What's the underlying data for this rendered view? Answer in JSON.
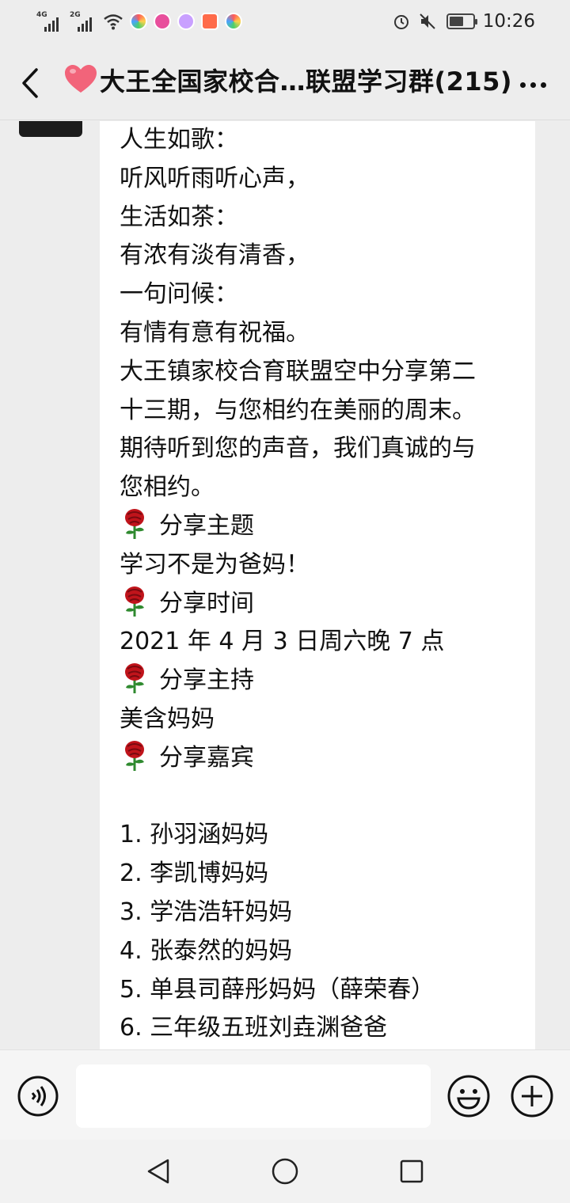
{
  "status_bar": {
    "signal_1_label": "4G",
    "signal_2_label": "2G",
    "time": "10:26",
    "battery_level_percent": 60,
    "app_icon_colors": [
      "#e84f9c",
      "#e84f9c",
      "#c9a0ff",
      "#ff6b4a",
      "#4aa3ff"
    ]
  },
  "header": {
    "title": "大王全国家校合…联盟学习群(215)",
    "title_icon": "heart-icon",
    "accent_color": "#f2647a"
  },
  "message": {
    "lines": [
      {
        "text": "人生如歌：",
        "rose": false
      },
      {
        "text": "听风听雨听心声，",
        "rose": false
      },
      {
        "text": "生活如茶：",
        "rose": false
      },
      {
        "text": "有浓有淡有清香，",
        "rose": false
      },
      {
        "text": "一句问候：",
        "rose": false
      },
      {
        "text": "有情有意有祝福。",
        "rose": false
      },
      {
        "text": "大王镇家校合育联盟空中分享第二",
        "rose": false
      },
      {
        "text": "十三期，与您相约在美丽的周末。",
        "rose": false
      },
      {
        "text": "期待听到您的声音，我们真诚的与",
        "rose": false
      },
      {
        "text": "您相约。",
        "rose": false
      },
      {
        "text": "分享主题",
        "rose": true
      },
      {
        "text": "学习不是为爸妈！",
        "rose": false
      },
      {
        "text": "分享时间",
        "rose": true
      },
      {
        "text": "2021 年 4 月 3 日周六晚 7 点",
        "rose": false
      },
      {
        "text": "分享主持",
        "rose": true
      },
      {
        "text": "美含妈妈",
        "rose": false
      },
      {
        "text": "分享嘉宾",
        "rose": true
      },
      {
        "text": "",
        "rose": false
      },
      {
        "text": "1. 孙羽涵妈妈",
        "rose": false
      },
      {
        "text": "2. 李凯博妈妈",
        "rose": false
      },
      {
        "text": "3. 学浩浩轩妈妈",
        "rose": false
      },
      {
        "text": "4. 张泰然的妈妈",
        "rose": false
      },
      {
        "text": "5. 单县司薛彤妈妈（薛荣春）",
        "rose": false
      },
      {
        "text": "6. 三年级五班刘垚渊爸爸",
        "rose": false
      }
    ]
  },
  "input_bar": {
    "value": "",
    "placeholder": ""
  },
  "colors": {
    "background": "#ededed",
    "bubble": "#ffffff",
    "rose": "#c0141b",
    "rose_stem": "#2f8a2f"
  }
}
